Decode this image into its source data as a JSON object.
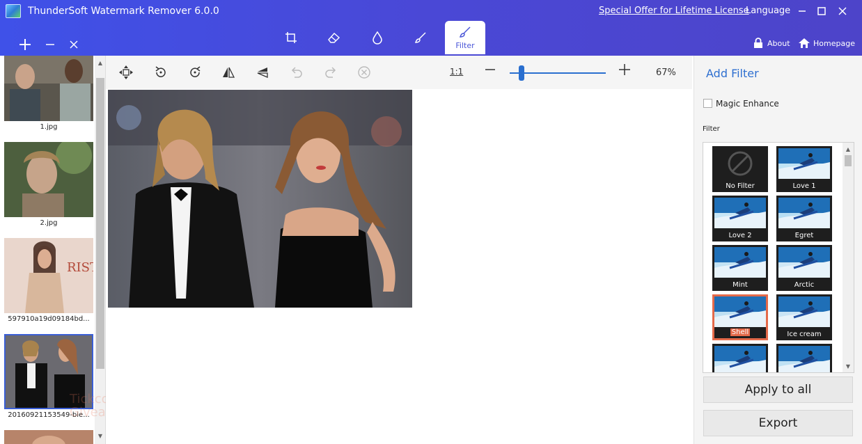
{
  "window": {
    "title": "ThunderSoft Watermark Remover 6.0.0",
    "offer_link": "Special Offer for Lifetime License",
    "language_label": "Language"
  },
  "toolbar": {
    "tabs": [
      {
        "icon": "crop-icon",
        "label": ""
      },
      {
        "icon": "eraser-icon",
        "label": ""
      },
      {
        "icon": "droplet-icon",
        "label": ""
      },
      {
        "icon": "brush-icon",
        "label": ""
      },
      {
        "icon": "filter-icon",
        "label": "Filter",
        "active": true
      }
    ],
    "about_label": "About",
    "homepage_label": "Homepage"
  },
  "files": [
    {
      "label": "1.jpg"
    },
    {
      "label": "2.jpg"
    },
    {
      "label": "597910a19d09184bd..."
    },
    {
      "label": "20160921153549-bie...",
      "selected": true
    }
  ],
  "canvas_toolbar": {
    "ratio_label": "1:1",
    "zoom_value": "67%",
    "zoom_fraction": 0.12
  },
  "right_panel": {
    "title": "Add Filter",
    "magic_enhance_label": "Magic Enhance",
    "filter_section_label": "Filter",
    "filters": [
      {
        "name": "No Filter"
      },
      {
        "name": "Love 1"
      },
      {
        "name": "Love 2"
      },
      {
        "name": "Egret"
      },
      {
        "name": "Mint"
      },
      {
        "name": "Arctic"
      },
      {
        "name": "Shell",
        "selected": true
      },
      {
        "name": "Ice cream"
      },
      {
        "name": ""
      },
      {
        "name": ""
      }
    ],
    "apply_all_label": "Apply to all",
    "export_label": "Export"
  },
  "watermark": {
    "line1": "Tickcoupon",
    "line2": "Giveaway"
  },
  "colors": {
    "header": "#4a48d6",
    "accent": "#2e6fd0",
    "selected_filter": "#e46a4a"
  }
}
